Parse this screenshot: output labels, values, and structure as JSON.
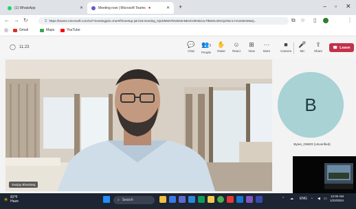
{
  "browser": {
    "tabs": [
      {
        "label": "(1) WhatsApp",
        "color": "#25d366"
      },
      {
        "label": "Meeting now | Microsoft Teams",
        "color": "#5b5fc7"
      }
    ],
    "new_tab": "+",
    "url": "https://teams.microsoft.com/v2/?meetingjoin=true#/l/meetup-join/19:meeting_NjU0MWVhNzItNmNkOC00NDcxLTlkMGUtZmQ2Nzc1Y2UzMmMwQ..."
  },
  "bookmarks": [
    {
      "label": "Gmail",
      "color": "#d93025"
    },
    {
      "label": "Maps",
      "color": "#34a853"
    },
    {
      "label": "YouTube",
      "color": "#ff0000"
    }
  ],
  "meeting": {
    "timer": "11:23",
    "controls": [
      {
        "label": "Chat",
        "icon": "chat-icon"
      },
      {
        "label": "People",
        "icon": "people-icon"
      },
      {
        "label": "Raise",
        "icon": "hand-icon"
      },
      {
        "label": "React",
        "icon": "emoji-icon"
      },
      {
        "label": "View",
        "icon": "grid-icon"
      },
      {
        "label": "More",
        "icon": "more-icon"
      },
      {
        "label": "Camera",
        "icon": "camera-icon"
      },
      {
        "label": "Mic",
        "icon": "mic-icon"
      },
      {
        "label": "Share",
        "icon": "share-icon"
      }
    ],
    "people_count": "3",
    "leave_label": "Leave"
  },
  "participants": {
    "main_name": "Sanjay Bhardwaj",
    "avatar_letter": "B",
    "avatar_name": "Bytes_OWER (Unverified)"
  },
  "taskbar": {
    "weather_temp": "82°F",
    "weather_desc": "Haze",
    "search_placeholder": "Search",
    "lang": "ENG",
    "time": "12:00 AM",
    "date": "1/22/2024"
  }
}
